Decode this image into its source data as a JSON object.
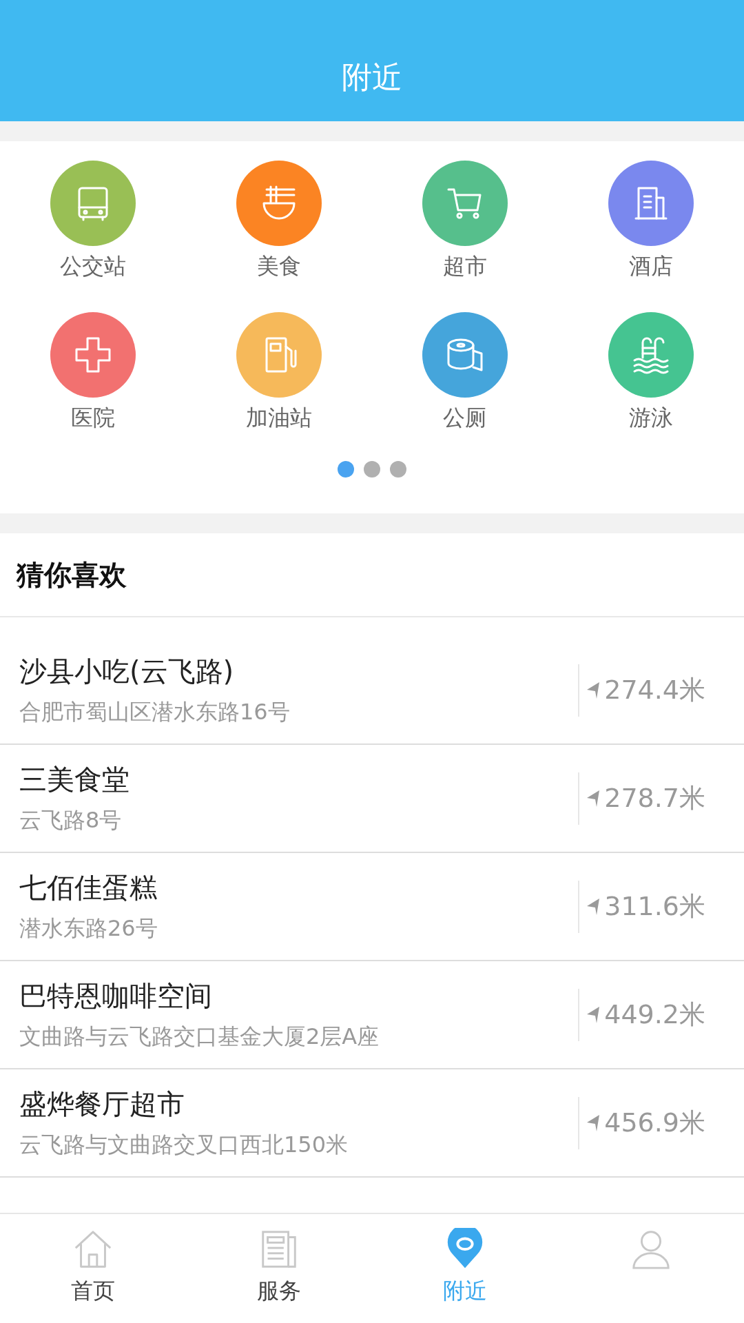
{
  "header": {
    "title": "附近"
  },
  "categories": [
    {
      "label": "公交站",
      "color": "#99bf55"
    },
    {
      "label": "美食",
      "color": "#fb8423"
    },
    {
      "label": "超市",
      "color": "#56bf8c"
    },
    {
      "label": "酒店",
      "color": "#7a88ee"
    },
    {
      "label": "医院",
      "color": "#f27170"
    },
    {
      "label": "加油站",
      "color": "#f6b95a"
    },
    {
      "label": "公厕",
      "color": "#45a5db"
    },
    {
      "label": "游泳",
      "color": "#45c491"
    }
  ],
  "pager": [
    {
      "selected": true
    },
    {
      "selected": false
    },
    {
      "selected": false
    }
  ],
  "section_title": "猜你喜欢",
  "places": [
    {
      "name": "沙县小吃(云飞路)",
      "address": "合肥市蜀山区潜水东路16号",
      "distance": "274.4米"
    },
    {
      "name": "三美食堂",
      "address": "云飞路8号",
      "distance": "278.7米"
    },
    {
      "name": "七佰佳蛋糕",
      "address": "潜水东路26号",
      "distance": "311.6米"
    },
    {
      "name": "巴特恩咖啡空间",
      "address": "文曲路与云飞路交口基金大厦2层A座",
      "distance": "449.2米"
    },
    {
      "name": "盛烨餐厅超市",
      "address": "云飞路与文曲路交叉口西北150米",
      "distance": "456.9米"
    }
  ],
  "tabs": [
    {
      "label": "首页",
      "selected": false
    },
    {
      "label": "服务",
      "selected": false
    },
    {
      "label": "附近",
      "selected": true
    },
    {
      "selected": false
    }
  ]
}
